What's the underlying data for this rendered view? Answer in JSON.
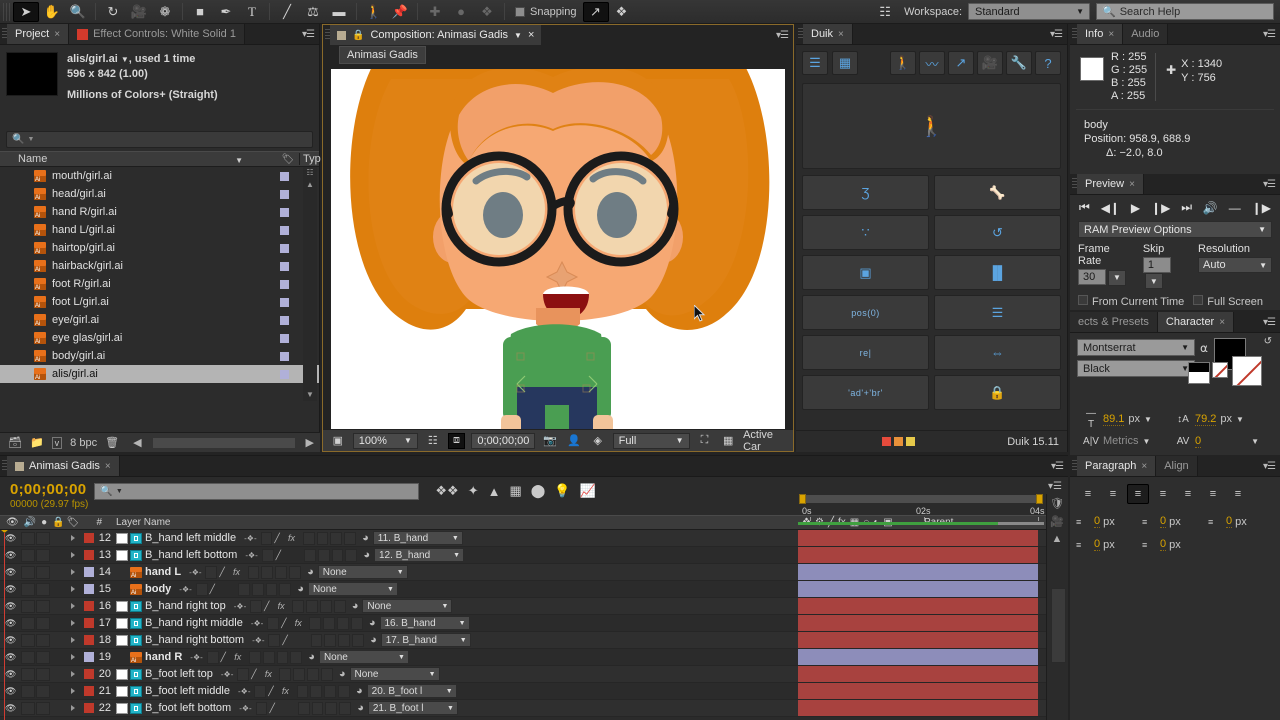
{
  "toolbar": {
    "tools": [
      {
        "name": "selection-tool",
        "glyph": "➤",
        "selected": true
      },
      {
        "name": "hand-tool",
        "glyph": "✋",
        "selected": false
      },
      {
        "name": "zoom-tool",
        "glyph": "🔍",
        "selected": false
      },
      {
        "name": "rotation-tool",
        "glyph": "↻",
        "selected": false
      },
      {
        "name": "camera-tool",
        "glyph": "🎥",
        "selected": false
      },
      {
        "name": "pan-behind-tool",
        "glyph": "❁",
        "selected": false
      },
      {
        "name": "shape-tool",
        "glyph": "■",
        "selected": false
      },
      {
        "name": "pen-tool",
        "glyph": "✒",
        "selected": false
      },
      {
        "name": "type-tool",
        "glyph": "T",
        "selected": false
      },
      {
        "name": "brush-tool",
        "glyph": "╱",
        "selected": false
      },
      {
        "name": "clone-stamp-tool",
        "glyph": "⚘",
        "selected": false
      },
      {
        "name": "eraser-tool",
        "glyph": "▬",
        "selected": false
      },
      {
        "name": "roto-brush-tool",
        "glyph": "🚶",
        "selected": false
      },
      {
        "name": "puppet-pin-tool",
        "glyph": "📌",
        "selected": false
      }
    ],
    "snapping_label": "Snapping",
    "snapping_checked": false,
    "workspace_label": "Workspace:",
    "workspace_value": "Standard",
    "search_help_placeholder": "Search Help"
  },
  "project": {
    "tabs": [
      {
        "label": "Project",
        "active": true,
        "closable": true
      },
      {
        "label": "Effect Controls: White Solid 1",
        "active": false,
        "closable": false
      }
    ],
    "item_name": "alis/girl.ai",
    "item_usage": ", used 1 time",
    "item_dimensions": "596 x 842 (1.00)",
    "item_colors": "Millions of Colors+ (Straight)",
    "search_placeholder": "",
    "columns": {
      "name": "Name",
      "type": "Typ"
    },
    "items": [
      {
        "label": "mouth/girl.ai",
        "selected": false
      },
      {
        "label": "head/girl.ai",
        "selected": false
      },
      {
        "label": "hand R/girl.ai",
        "selected": false
      },
      {
        "label": "hand L/girl.ai",
        "selected": false
      },
      {
        "label": "hairtop/girl.ai",
        "selected": false
      },
      {
        "label": "hairback/girl.ai",
        "selected": false
      },
      {
        "label": "foot R/girl.ai",
        "selected": false
      },
      {
        "label": "foot L/girl.ai",
        "selected": false
      },
      {
        "label": "eye/girl.ai",
        "selected": false
      },
      {
        "label": "eye glas/girl.ai",
        "selected": false
      },
      {
        "label": "body/girl.ai",
        "selected": false
      },
      {
        "label": "alis/girl.ai",
        "selected": true
      }
    ],
    "footer_bpc": "8 bpc"
  },
  "composition": {
    "tab_label": "Composition: Animasi Gadis",
    "breadcrumb": "Animasi Gadis",
    "zoom": "100%",
    "timecode": "0;00;00;00",
    "quality": "Full",
    "view": "Active Car"
  },
  "duik": {
    "tab_label": "Duik",
    "top_left_buttons": [
      {
        "name": "duik-list-view",
        "glyph": "☰"
      },
      {
        "name": "duik-grid-view",
        "glyph": "▦"
      }
    ],
    "top_right_buttons": [
      {
        "name": "duik-rigging-icon",
        "glyph": "🚶"
      },
      {
        "name": "duik-animation-icon",
        "glyph": "〰"
      },
      {
        "name": "duik-curve-icon",
        "glyph": "↗"
      },
      {
        "name": "duik-camera-icon",
        "glyph": "🎥"
      },
      {
        "name": "duik-tools-icon",
        "glyph": "🔧"
      },
      {
        "name": "duik-help-icon",
        "glyph": "?"
      }
    ],
    "stage_icon": "character-stage-icon",
    "cells": [
      {
        "name": "duik-autorig",
        "glyph": "Ʒ",
        "text": ""
      },
      {
        "name": "duik-bones",
        "glyph": "🦴",
        "text": ""
      },
      {
        "name": "duik-ik",
        "glyph": "∵",
        "text": ""
      },
      {
        "name": "duik-bake",
        "glyph": "↺",
        "text": ""
      },
      {
        "name": "duik-controllers",
        "glyph": "▣",
        "text": ""
      },
      {
        "name": "duik-separate-dimensions",
        "glyph": "▐▌",
        "text": ""
      },
      {
        "name": "duik-position-expression",
        "glyph": "",
        "text": "pos(0)"
      },
      {
        "name": "duik-list",
        "glyph": "☰",
        "text": ""
      },
      {
        "name": "duik-relative-expression",
        "glyph": "",
        "text": "re|"
      },
      {
        "name": "duik-spacing",
        "glyph": "⇔",
        "text": ""
      },
      {
        "name": "duik-add-brackets",
        "glyph": "",
        "text": "'ad'+'br'"
      },
      {
        "name": "duik-lock",
        "glyph": "🔒",
        "text": ""
      }
    ],
    "version": "Duik 15.11",
    "dot_colors": [
      "#e64b3c",
      "#e8913a",
      "#e6c94a"
    ]
  },
  "info": {
    "tabs": [
      {
        "label": "Info",
        "active": true
      },
      {
        "label": "Audio",
        "active": false
      }
    ],
    "r": "R : 255",
    "g": "G : 255",
    "b": "B : 255",
    "a": "A : 255",
    "x": "X : 1340",
    "y": "Y : 756",
    "layer_name": "body",
    "position": "Position: 958.9, 688.9",
    "delta": "Δ: −2.0, 8.0"
  },
  "preview": {
    "tab_label": "Preview",
    "transport": [
      {
        "name": "first-frame-button",
        "glyph": "⏮"
      },
      {
        "name": "previous-frame-button",
        "glyph": "◀❘"
      },
      {
        "name": "play-button",
        "glyph": "▶"
      },
      {
        "name": "next-frame-button",
        "glyph": "❘▶"
      },
      {
        "name": "last-frame-button",
        "glyph": "⏭"
      },
      {
        "name": "audio-toggle-button",
        "glyph": "🔊"
      },
      {
        "name": "loop-button",
        "glyph": "—"
      },
      {
        "name": "ram-preview-button",
        "glyph": "⏩"
      }
    ],
    "options_label": "RAM Preview Options",
    "frame_rate_label": "Frame Rate",
    "frame_rate_value": "30",
    "skip_label": "Skip",
    "skip_value": "1",
    "resolution_label": "Resolution",
    "resolution_value": "Auto",
    "from_current_time_label": "From Current Time",
    "full_screen_label": "Full Screen"
  },
  "character": {
    "tabs": [
      {
        "label": "ects & Presets",
        "active": false
      },
      {
        "label": "Character",
        "active": true
      }
    ],
    "font_family": "Montserrat",
    "font_style": "Black",
    "font_size": "89.1",
    "font_size_unit": "px",
    "leading": "79.2",
    "leading_unit": "px",
    "kerning": "Metrics",
    "tracking": "0"
  },
  "paragraph": {
    "tabs": [
      {
        "label": "Paragraph",
        "active": true
      },
      {
        "label": "Align",
        "active": false
      }
    ],
    "alignments": [
      {
        "name": "align-left",
        "glyph": "≡",
        "selected": false
      },
      {
        "name": "align-center",
        "glyph": "≡",
        "selected": false
      },
      {
        "name": "align-right",
        "glyph": "≡",
        "selected": true
      },
      {
        "name": "justify-last-left",
        "glyph": "≡",
        "selected": false
      },
      {
        "name": "justify-last-center",
        "glyph": "≡",
        "selected": false
      },
      {
        "name": "justify-last-right",
        "glyph": "≡",
        "selected": false
      },
      {
        "name": "justify-all",
        "glyph": "≡",
        "selected": false
      }
    ],
    "fields": [
      {
        "name": "indent-left",
        "value": "0",
        "unit": "px"
      },
      {
        "name": "indent-right",
        "value": "0",
        "unit": "px"
      },
      {
        "name": "indent-first-line",
        "value": "0",
        "unit": "px"
      },
      {
        "name": "space-before",
        "value": "0",
        "unit": "px"
      },
      {
        "name": "space-after",
        "value": "0",
        "unit": "px"
      }
    ]
  },
  "timeline": {
    "tab_label": "Animasi Gadis",
    "timecode": "0;00;00;00",
    "frames": "00000 (29.97 fps)",
    "search_placeholder": "",
    "columns": {
      "layer_name": "Layer Name",
      "parent": "Parent",
      "hash": "#"
    },
    "ruler_labels": [
      "0s",
      "02s",
      "04s"
    ],
    "layers": [
      {
        "index": "12",
        "name": "B_hand left middle",
        "bold": false,
        "color": "#c0392b",
        "source": "shape",
        "parent": "11. B_hand",
        "fx": true,
        "bar": "#a8423f"
      },
      {
        "index": "13",
        "name": "B_hand left bottom",
        "bold": false,
        "color": "#c0392b",
        "source": "shape",
        "parent": "12. B_hand",
        "fx": false,
        "bar": "#a8423f"
      },
      {
        "index": "14",
        "name": "hand L",
        "bold": true,
        "color": "#b0b0d8",
        "source": "ai",
        "parent": "None",
        "fx": true,
        "bar": "#8d8dba"
      },
      {
        "index": "15",
        "name": "body",
        "bold": true,
        "color": "#b0b0d8",
        "source": "ai",
        "parent": "None",
        "fx": false,
        "bar": "#8d8dba"
      },
      {
        "index": "16",
        "name": "B_hand right top",
        "bold": false,
        "color": "#c0392b",
        "source": "shape",
        "parent": "None",
        "fx": true,
        "bar": "#a8423f"
      },
      {
        "index": "17",
        "name": "B_hand right middle",
        "bold": false,
        "color": "#c0392b",
        "source": "shape",
        "parent": "16. B_hand",
        "fx": true,
        "bar": "#a8423f"
      },
      {
        "index": "18",
        "name": "B_hand right bottom",
        "bold": false,
        "color": "#c0392b",
        "source": "shape",
        "parent": "17. B_hand",
        "fx": false,
        "bar": "#a8423f"
      },
      {
        "index": "19",
        "name": "hand R",
        "bold": true,
        "color": "#b0b0d8",
        "source": "ai",
        "parent": "None",
        "fx": true,
        "bar": "#8d8dba"
      },
      {
        "index": "20",
        "name": "B_foot left top",
        "bold": false,
        "color": "#c0392b",
        "source": "shape",
        "parent": "None",
        "fx": true,
        "bar": "#a8423f"
      },
      {
        "index": "21",
        "name": "B_foot left middle",
        "bold": false,
        "color": "#c0392b",
        "source": "shape",
        "parent": "20. B_foot l",
        "fx": true,
        "bar": "#a8423f"
      },
      {
        "index": "22",
        "name": "B_foot left bottom",
        "bold": false,
        "color": "#c0392b",
        "source": "shape",
        "parent": "21. B_foot l",
        "fx": false,
        "bar": "#a8423f"
      }
    ]
  }
}
